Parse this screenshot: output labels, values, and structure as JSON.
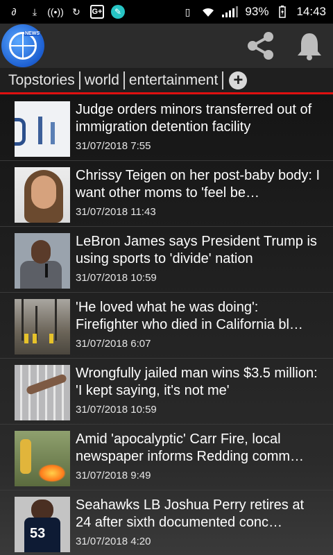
{
  "status_bar": {
    "battery": "93%",
    "time": "14:43"
  },
  "tabs": [
    "Topstories",
    "world",
    "entertainment"
  ],
  "feed": [
    {
      "headline": "Judge orders minors transferred out of immigration detention facility",
      "date": "31/07/2018 7:55"
    },
    {
      "headline": "Chrissy Teigen on her post-baby body: I want other moms to 'feel be…",
      "date": "31/07/2018 11:43"
    },
    {
      "headline": "LeBron James says President Trump is using sports to 'divide' nation",
      "date": "31/07/2018 10:59"
    },
    {
      "headline": "'He loved what he was doing': Firefighter who died in California bl…",
      "date": "31/07/2018 6:07"
    },
    {
      "headline": "Wrongfully jailed man wins $3.5 million: 'I kept saying, it's not me'",
      "date": "31/07/2018 10:59"
    },
    {
      "headline": "Amid 'apocalyptic' Carr Fire, local newspaper informs Redding comm…",
      "date": "31/07/2018 9:49"
    },
    {
      "headline": "Seahawks LB Joshua Perry retires at 24 after sixth documented conc…",
      "date": "31/07/2018 4:20"
    }
  ],
  "colors": {
    "accent_line": "#e01010",
    "app_bar": "#2c2c2c",
    "logo_blue": "#1d5fd1"
  },
  "icons": {
    "share": "share-icon",
    "notifications": "bell-icon",
    "add_tab": "plus-icon"
  }
}
